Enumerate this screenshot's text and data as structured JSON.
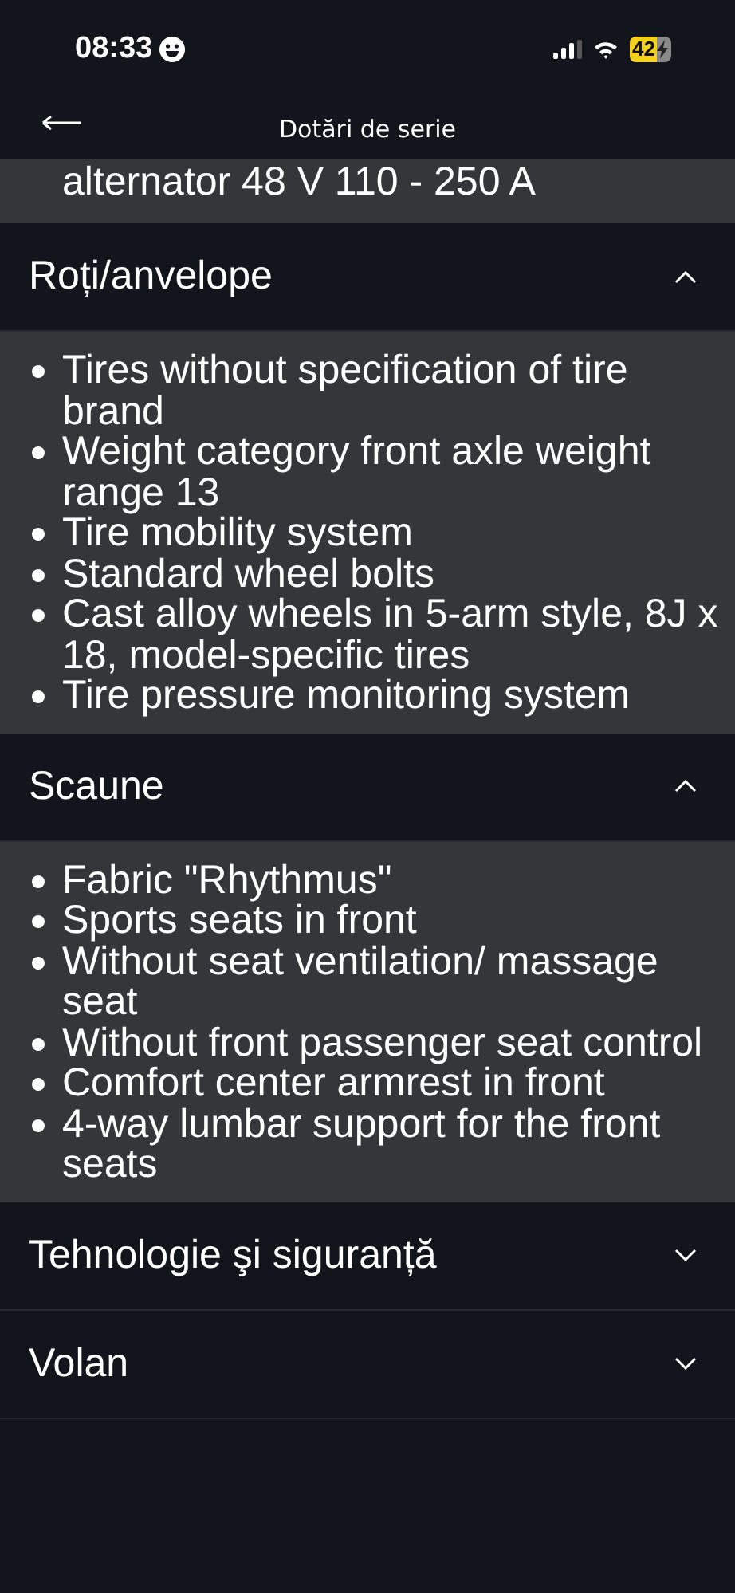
{
  "status_bar": {
    "time": "08:33",
    "battery": "42"
  },
  "header": {
    "title": "Dotări de serie"
  },
  "cut_item": "alternator 48 V 110 - 250 A",
  "sections": [
    {
      "title": "Roți/anvelope",
      "expanded": true,
      "items": [
        "Tires without specification of tire brand",
        "Weight category front axle weight range 13",
        "Tire mobility system",
        "Standard wheel bolts",
        "Cast alloy wheels in 5-arm style, 8J x 18, model-specific tires",
        "Tire pressure monitoring system"
      ]
    },
    {
      "title": "Scaune",
      "expanded": true,
      "items": [
        "Fabric \"Rhythmus\"",
        "Sports seats in front",
        "Without seat ventilation/ massage seat",
        "Without front passenger seat control",
        "Comfort center armrest in front",
        "4-way lumbar support for the front seats"
      ]
    },
    {
      "title": "Tehnologie şi siguranță",
      "expanded": false
    },
    {
      "title": "Volan",
      "expanded": false
    }
  ]
}
